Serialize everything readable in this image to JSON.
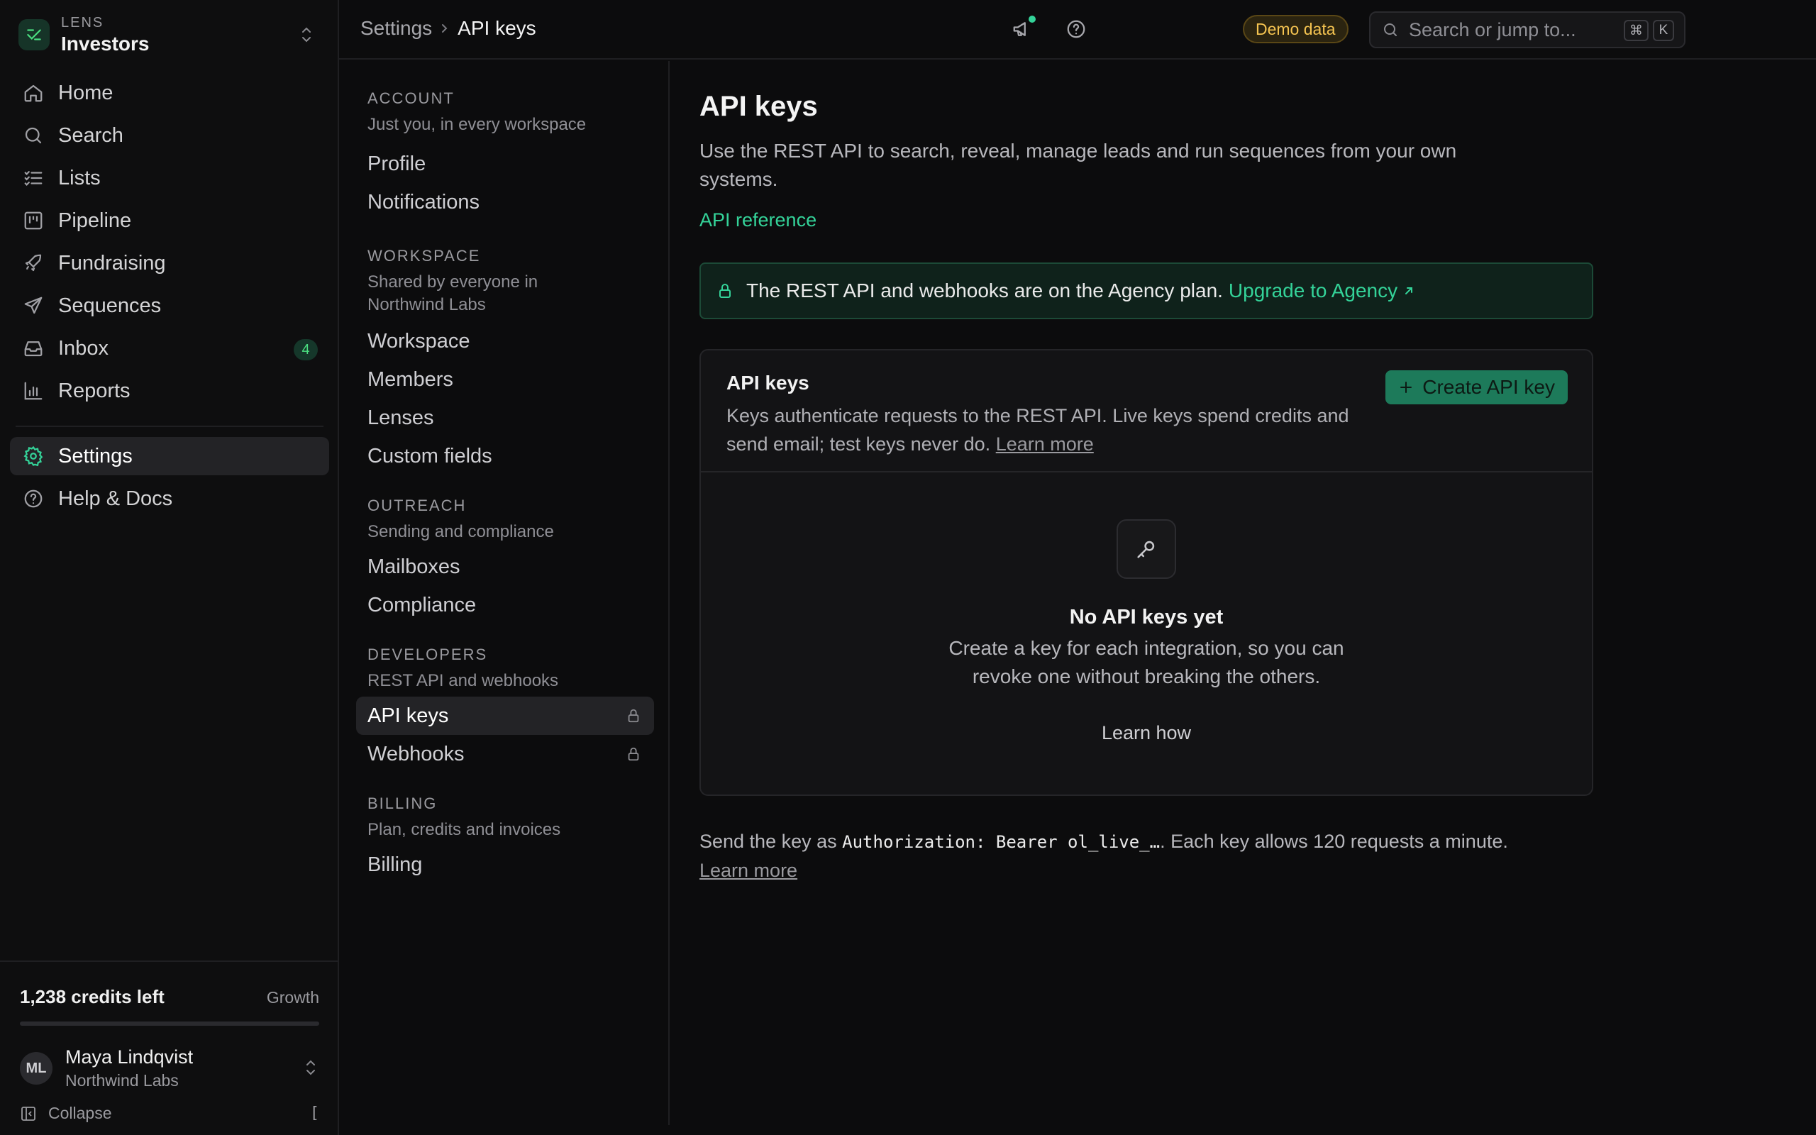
{
  "workspace": {
    "overline": "LENS",
    "name": "Investors"
  },
  "nav": {
    "items": [
      {
        "label": "Home",
        "icon": "home-icon"
      },
      {
        "label": "Search",
        "icon": "search-icon"
      },
      {
        "label": "Lists",
        "icon": "list-icon"
      },
      {
        "label": "Pipeline",
        "icon": "kanban-icon"
      },
      {
        "label": "Fundraising",
        "icon": "rocket-icon"
      },
      {
        "label": "Sequences",
        "icon": "send-icon"
      },
      {
        "label": "Inbox",
        "icon": "inbox-icon",
        "badge": "4"
      },
      {
        "label": "Reports",
        "icon": "bar-chart-icon"
      }
    ],
    "secondary": [
      {
        "label": "Settings",
        "icon": "gear-icon",
        "active": true
      },
      {
        "label": "Help & Docs",
        "icon": "help-circle-icon"
      }
    ]
  },
  "credits": {
    "text": "1,238 credits left",
    "plan": "Growth",
    "used_fraction": 0.0
  },
  "user": {
    "initials": "ML",
    "name": "Maya Lindqvist",
    "org": "Northwind Labs"
  },
  "collapse": {
    "label": "Collapse",
    "shortcut": "["
  },
  "breadcrumb": {
    "parent": "Settings",
    "current": "API keys"
  },
  "topbar": {
    "demo_badge": "Demo data",
    "search_placeholder": "Search or jump to...",
    "kbd_cmd": "⌘",
    "kbd_key": "K"
  },
  "settings_nav": {
    "sections": [
      {
        "title": "ACCOUNT",
        "subtitle": "Just you, in every workspace",
        "items": [
          {
            "label": "Profile"
          },
          {
            "label": "Notifications"
          }
        ]
      },
      {
        "title": "WORKSPACE",
        "subtitle": "Shared by everyone in Northwind Labs",
        "items": [
          {
            "label": "Workspace"
          },
          {
            "label": "Members"
          },
          {
            "label": "Lenses"
          },
          {
            "label": "Custom fields"
          }
        ]
      },
      {
        "title": "OUTREACH",
        "subtitle": "Sending and compliance",
        "items": [
          {
            "label": "Mailboxes"
          },
          {
            "label": "Compliance"
          }
        ]
      },
      {
        "title": "DEVELOPERS",
        "subtitle": "REST API and webhooks",
        "items": [
          {
            "label": "API keys",
            "locked": true,
            "active": true
          },
          {
            "label": "Webhooks",
            "locked": true
          }
        ]
      },
      {
        "title": "BILLING",
        "subtitle": "Plan, credits and invoices",
        "items": [
          {
            "label": "Billing"
          }
        ]
      }
    ]
  },
  "main": {
    "title": "API keys",
    "description": "Use the REST API to search, reveal, manage leads and run sequences from your own systems.",
    "api_reference": "API reference",
    "banner": {
      "text": "The REST API and webhooks are on the Agency plan.",
      "link": "Upgrade to Agency"
    },
    "card": {
      "title": "API keys",
      "description": "Keys authenticate requests to the REST API. Live keys spend credits and send email; test keys never do.",
      "learn_more": "Learn more",
      "create_button": "Create API key",
      "empty_title": "No API keys yet",
      "empty_desc": "Create a key for each integration, so you can revoke one without breaking the others.",
      "empty_link": "Learn how"
    },
    "note": {
      "prefix": "Send the key as",
      "code": "Authorization: Bearer ol_live_…",
      "suffix": ". Each key allows 120 requests a minute.",
      "link": "Learn more"
    }
  },
  "colors": {
    "accent": "#34d399",
    "button": "#1d7a5a",
    "demo": "#f5c451"
  }
}
